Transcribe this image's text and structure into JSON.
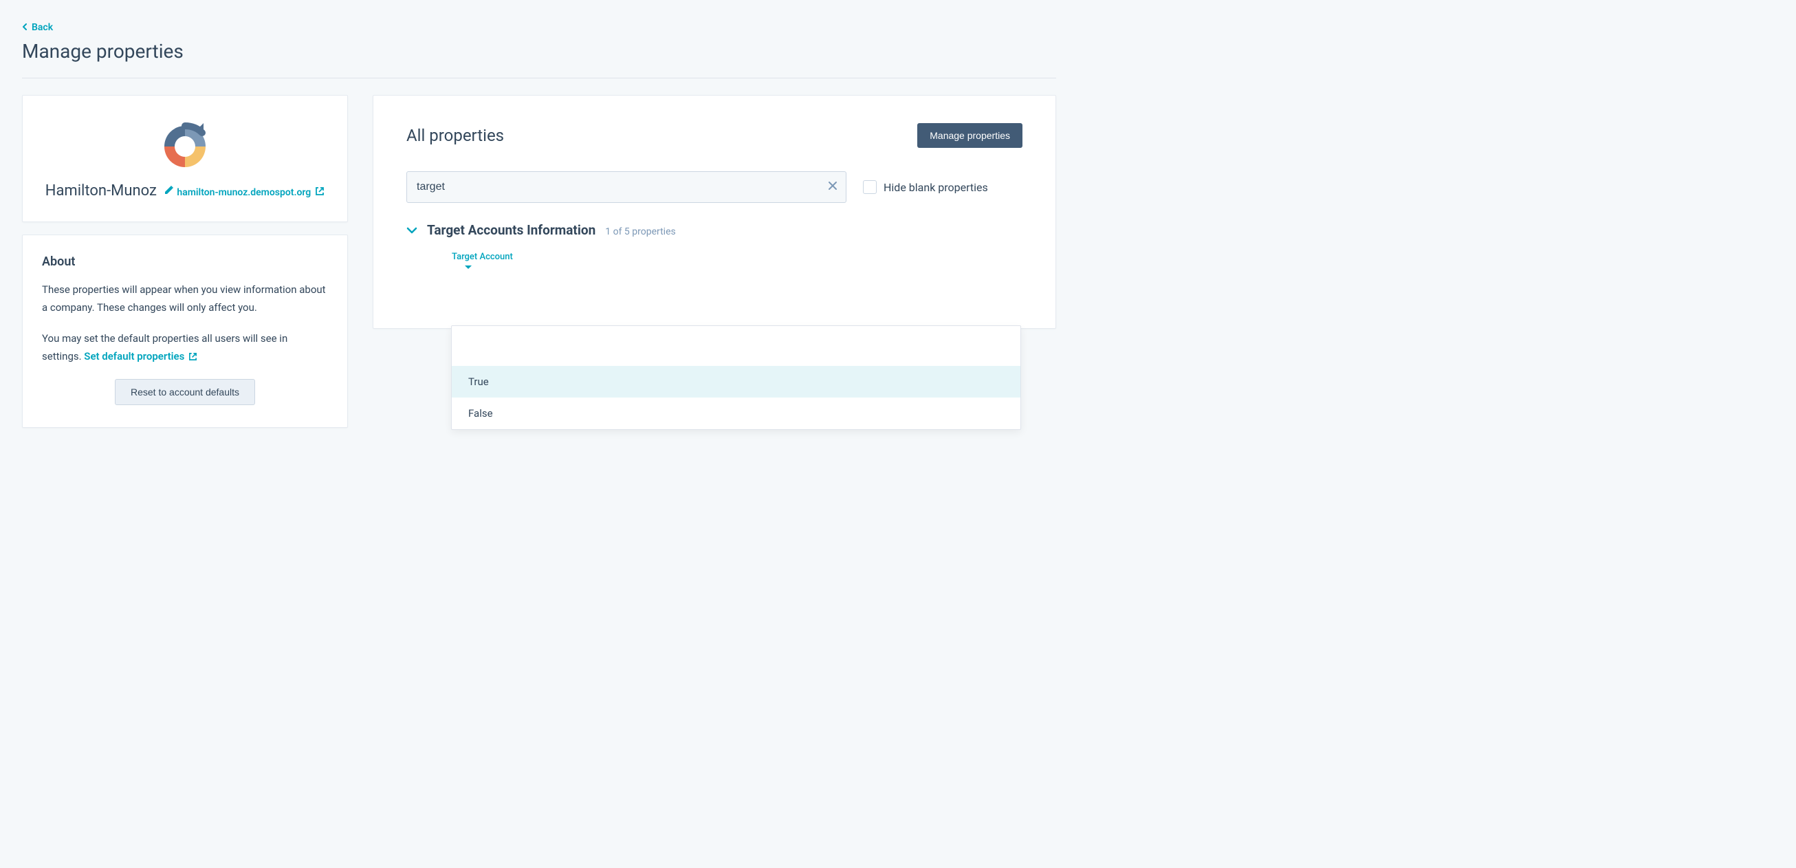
{
  "nav": {
    "back_label": "Back",
    "page_title": "Manage properties"
  },
  "company": {
    "name": "Hamilton-Munoz",
    "url": "hamilton-munoz.demospot.org"
  },
  "about": {
    "heading": "About",
    "paragraph1": "These properties will appear when you view information about a company. These changes will only affect you.",
    "paragraph2_prefix": "You may set the default properties all users will see in settings. ",
    "set_defaults_link": "Set default properties",
    "reset_button": "Reset to account defaults"
  },
  "main": {
    "heading": "All properties",
    "manage_button": "Manage properties",
    "search_value": "target",
    "hide_blank_label": "Hide blank properties"
  },
  "group": {
    "title": "Target Accounts Information",
    "count_text": "1 of 5 properties"
  },
  "property": {
    "label": "Target Account",
    "options": [
      "True",
      "False"
    ],
    "highlighted_index": 0
  }
}
